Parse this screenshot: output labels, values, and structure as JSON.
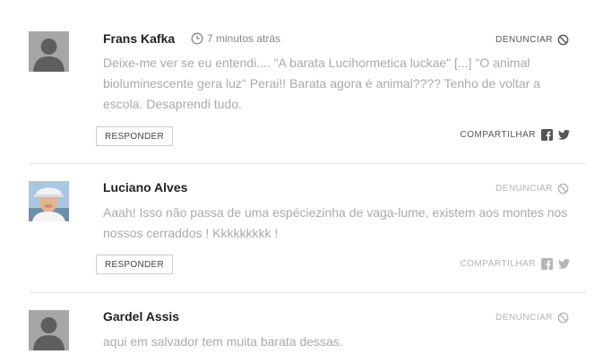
{
  "comments": [
    {
      "author": "Frans Kafka",
      "time": "7 minutos atrás",
      "report_label": "DENUNCIAR",
      "text": "Deixe-me ver se eu entendi.... \"A barata Lucihormetica luckae\" [...] \"O animal bioluminescente gera luz\" Perai!! Barata agora é animal???? Tenho de voltar a escola. Desaprendi tudo.",
      "reply_label": "RESPONDER",
      "share_label": "COMPARTILHAR",
      "avatar": "default-silhouette-icon"
    },
    {
      "author": "Luciano Alves",
      "report_label": "DENUNCIAR",
      "text": "Aaah! Isso não passa de uma espéciezinha de vaga-lume, existem aos montes nos nossos cerraddos ! Kkkkkkkkk !",
      "reply_label": "RESPONDER",
      "share_label": "COMPARTILHAR",
      "avatar": "user-photo"
    },
    {
      "author": "Gardel Assis",
      "report_label": "DENUNCIAR",
      "text": "aqui em salvador tem muita barata dessas.",
      "avatar": "default-silhouette-icon"
    }
  ],
  "icons": {
    "clock": "clock-icon",
    "report": "ban-icon",
    "facebook": "facebook-icon",
    "twitter": "twitter-icon"
  },
  "colors": {
    "author": "#222222",
    "body_text": "#aaaaaa",
    "divider": "#e6e6e6",
    "avatar_bg": "#a6a6a6"
  }
}
